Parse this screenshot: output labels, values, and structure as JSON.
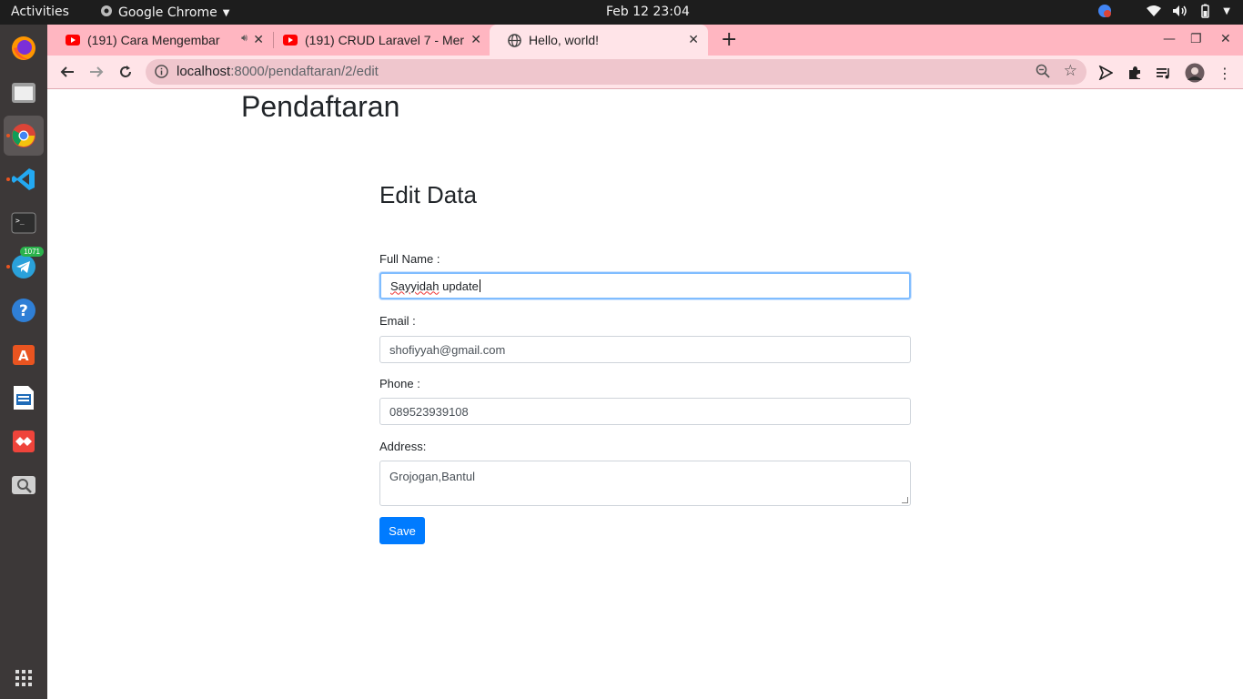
{
  "topbar": {
    "activities": "Activities",
    "app_name": "Google Chrome",
    "clock": "Feb 12  23:04"
  },
  "dock": {
    "apps": [
      "firefox-icon",
      "files-icon",
      "chrome-icon",
      "vscode-icon",
      "terminal-icon",
      "telegram-icon",
      "help-icon",
      "software-icon",
      "writer-icon",
      "anydesk-icon",
      "screenshot-icon"
    ],
    "telegram_badge": "1071"
  },
  "browser": {
    "tabs": [
      {
        "title": "(191) Cara Mengembar",
        "icon": "youtube-icon",
        "audio": true
      },
      {
        "title": "(191) CRUD Laravel 7 - Mer",
        "icon": "youtube-icon",
        "audio": false
      },
      {
        "title": "Hello, world!",
        "icon": "globe-icon",
        "audio": false
      }
    ],
    "url_host": "localhost",
    "url_path": ":8000/pendaftaran/2/edit",
    "colors": {
      "tabstrip": "#ffb6c1",
      "toolbar": "#ffe4e8"
    }
  },
  "page": {
    "site_title": "Pendaftaran",
    "form_title": "Edit Data",
    "fields": {
      "fullname_label": "Full Name :",
      "fullname_value_a": "Sayyidah",
      "fullname_value_b": " update",
      "email_label": "Email :",
      "email_value": "shofiyyah@gmail.com",
      "phone_label": "Phone :",
      "phone_value": "089523939108",
      "address_label": "Address:",
      "address_value": "Grojogan,Bantul"
    },
    "save_label": "Save",
    "colors": {
      "primary": "#007bff",
      "focus": "#80bdff"
    }
  }
}
